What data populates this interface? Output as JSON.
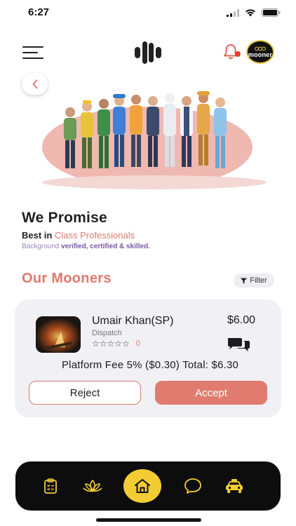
{
  "status_bar": {
    "time": "6:27"
  },
  "header": {
    "menu_icon": "hamburger-icon",
    "logo_icon": "mooner-logo-icon",
    "notification_icon": "bell-icon",
    "avatar_brand": "mooner"
  },
  "promise": {
    "title": "We Promise",
    "line1_prefix": "Best in ",
    "line1_accent": "Class Professionals",
    "line2_prefix": "Background ",
    "line2_strong": "verified, certified & skilled."
  },
  "section": {
    "title": "Our Mooners",
    "filter_label": "Filter"
  },
  "offer_card": {
    "name": "Umair Khan(SP)",
    "role": "Dispatch",
    "stars": "☆☆☆☆☆",
    "rating_count": "0",
    "price": "$6.00",
    "fee_text": "Platform Fee 5% ($0.30) Total: $6.30",
    "reject_label": "Reject",
    "accept_label": "Accept"
  },
  "bottom_nav": {
    "items": [
      "clipboard-icon",
      "lotus-icon",
      "home-icon",
      "chat-bubble-icon",
      "taxi-icon"
    ],
    "active": "home-icon"
  },
  "colors": {
    "accent": "#df7a6d",
    "nav_bg": "#0d0d0d",
    "nav_icon": "#f2cc32",
    "card_bg": "#f0f0f5",
    "purple": "#7d57a8"
  }
}
